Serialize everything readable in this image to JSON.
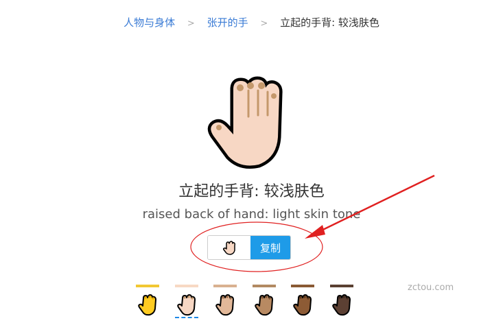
{
  "breadcrumb": {
    "items": [
      "人物与身体",
      "张开的手"
    ],
    "separator": ">",
    "current": "立起的手背: 较浅肤色"
  },
  "emoji": {
    "title": "立起的手背: 较浅肤色",
    "subtitle": "raised back of hand: light skin tone",
    "glyph": "🤚🏻",
    "skin_color": "#f7d7c4",
    "nail_color": "#c4986b"
  },
  "copy": {
    "button_label": "复制"
  },
  "watermark": "zctou.com",
  "skin_tones": [
    {
      "bar": "#f2c833",
      "skin": "#ffcc22",
      "nail": "#e0a800",
      "selected": false
    },
    {
      "bar": "#f7d9c4",
      "skin": "#f7d7c4",
      "nail": "#c4986b",
      "selected": true
    },
    {
      "bar": "#d9b190",
      "skin": "#e2b899",
      "nail": "#9b6b48",
      "selected": false
    },
    {
      "bar": "#b28a62",
      "skin": "#b88a62",
      "nail": "#7a5234",
      "selected": false
    },
    {
      "bar": "#8a5a34",
      "skin": "#8d5b35",
      "nail": "#5a3518",
      "selected": false
    },
    {
      "bar": "#5a4032",
      "skin": "#5c4033",
      "nail": "#3a261b",
      "selected": false
    }
  ],
  "annotation_color": "#e02020"
}
